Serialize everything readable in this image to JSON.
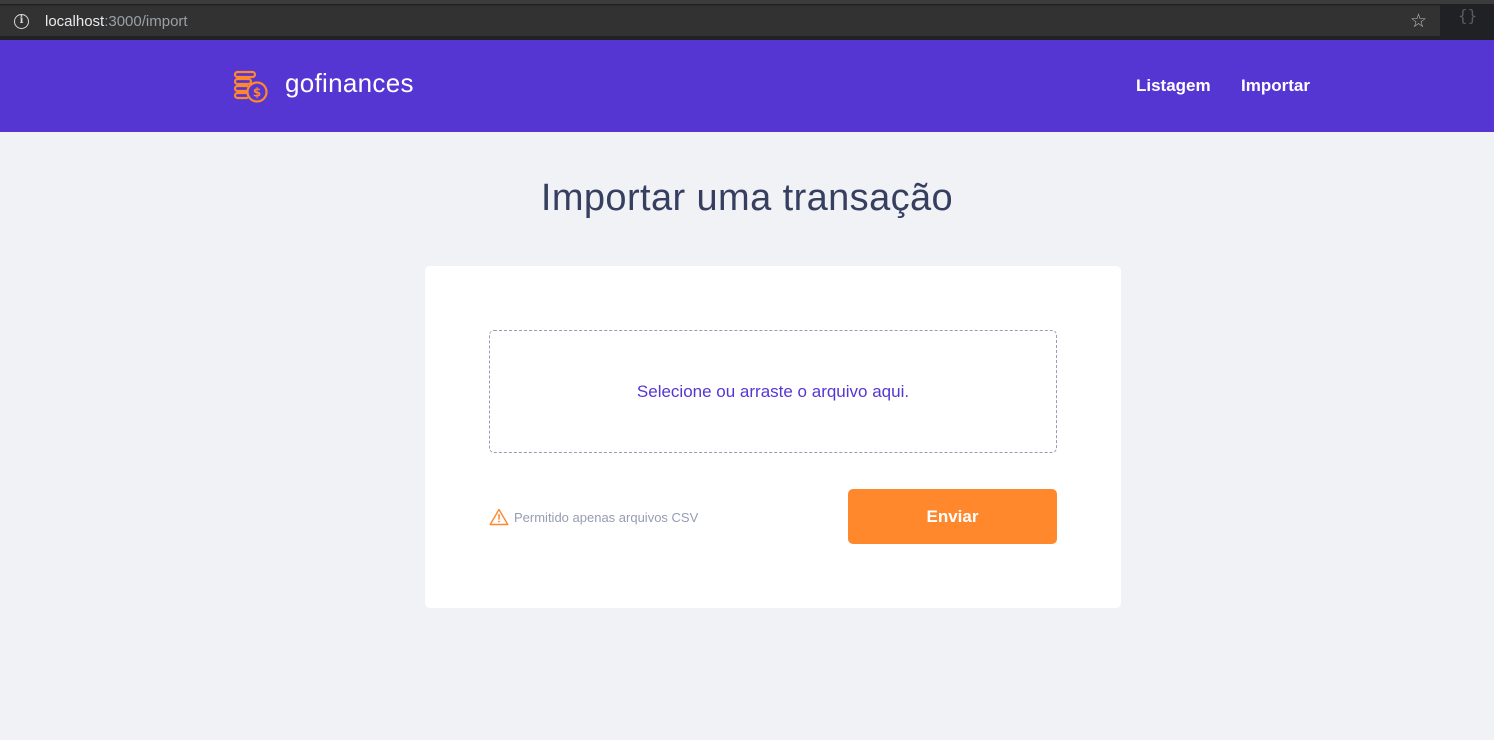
{
  "browser": {
    "url_host": "localhost",
    "url_path": ":3000/import",
    "star_icon": "star-icon",
    "info_icon": "info-icon"
  },
  "header": {
    "brand": "gofinances",
    "logo_icon": "coins-dollar-icon",
    "nav": [
      {
        "label": "Listagem"
      },
      {
        "label": "Importar"
      }
    ]
  },
  "main": {
    "title": "Importar uma transação",
    "dropzone_text": "Selecione ou arraste o arquivo aqui.",
    "warning_text": "Permitido apenas arquivos CSV",
    "warning_icon": "alert-triangle-icon",
    "submit_label": "Enviar"
  },
  "colors": {
    "primary": "#5636d3",
    "accent": "#ff872c",
    "title": "#363f5f",
    "muted": "#969cb3",
    "background": "#f0f2f5"
  }
}
